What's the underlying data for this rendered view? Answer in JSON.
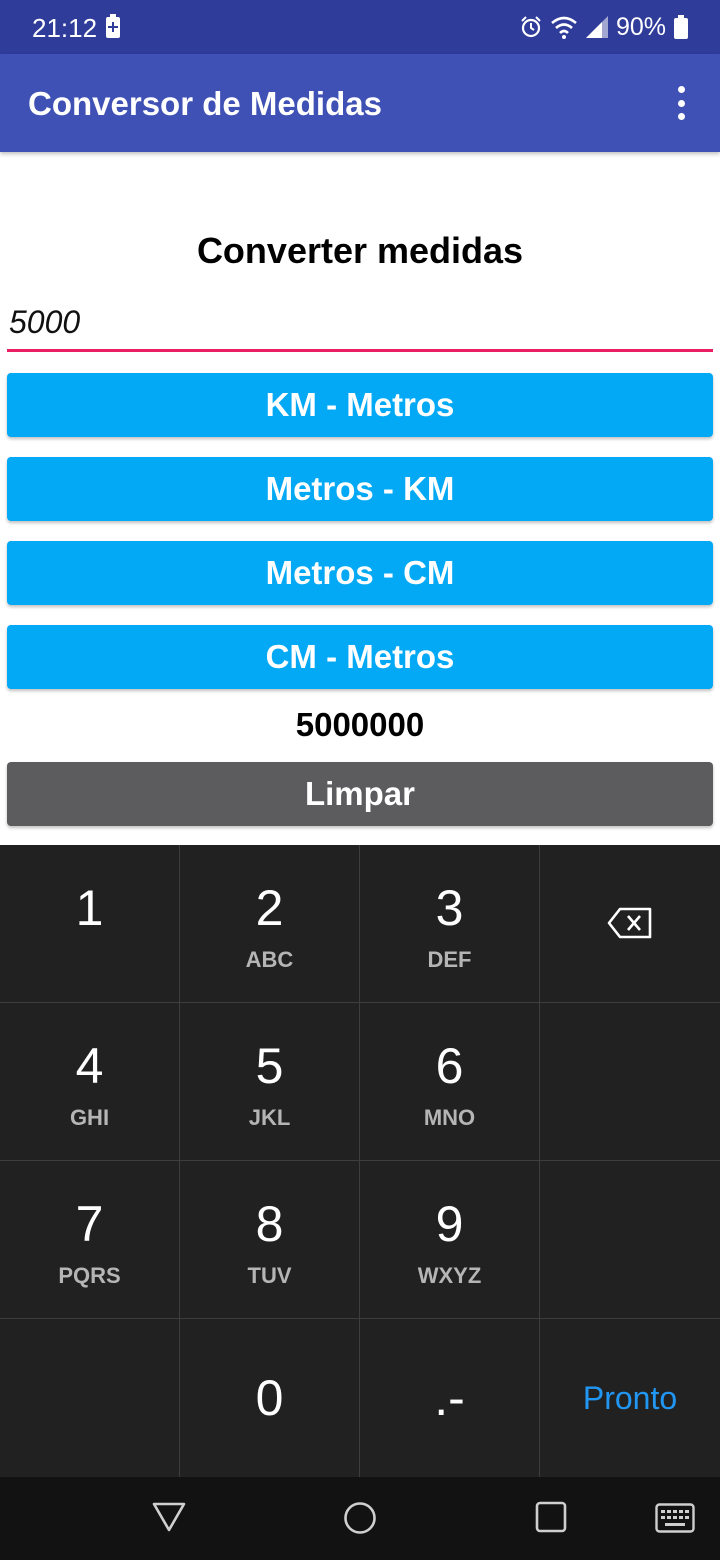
{
  "status": {
    "time": "21:12",
    "battery": "90%",
    "icons": [
      "battery-charging-icon",
      "alarm-icon",
      "wifi-icon",
      "signal-icon",
      "battery-icon"
    ]
  },
  "app": {
    "title": "Conversor de Medidas",
    "menu_icon": "overflow-menu-icon",
    "primary_color": "#3f51b5",
    "status_color": "#2f3c9a"
  },
  "main": {
    "heading": "Converter medidas",
    "input_value": "5000",
    "accent_color": "#e91e63",
    "buttons": [
      {
        "label": "KM - Metros"
      },
      {
        "label": "Metros - KM"
      },
      {
        "label": "Metros - CM"
      },
      {
        "label": "CM - Metros"
      }
    ],
    "button_color": "#03a9f4",
    "result": "5000000",
    "clear_label": "Limpar",
    "clear_color": "#5c5c5e"
  },
  "keyboard": {
    "keys": [
      {
        "num": "1",
        "sub": ""
      },
      {
        "num": "2",
        "sub": "ABC"
      },
      {
        "num": "3",
        "sub": "DEF"
      },
      {
        "num": "4",
        "sub": "GHI"
      },
      {
        "num": "5",
        "sub": "JKL"
      },
      {
        "num": "6",
        "sub": "MNO"
      },
      {
        "num": "7",
        "sub": "PQRS"
      },
      {
        "num": "8",
        "sub": "TUV"
      },
      {
        "num": "9",
        "sub": "WXYZ"
      },
      {
        "num": "0",
        "sub": ""
      },
      {
        "num": ".-",
        "sub": ""
      }
    ],
    "done_label": "Pronto",
    "done_color": "#2196f3",
    "backspace_icon": "backspace-icon"
  },
  "nav": {
    "icons": [
      "back-triangle-icon",
      "home-circle-icon",
      "recents-square-icon",
      "keyboard-icon"
    ]
  }
}
